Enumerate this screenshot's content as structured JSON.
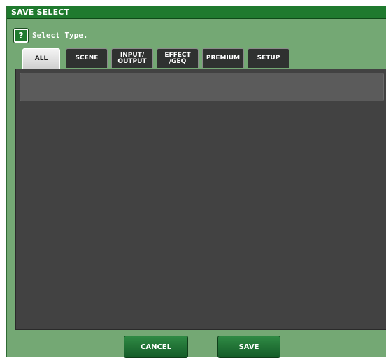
{
  "window": {
    "title": "SAVE SELECT"
  },
  "prompt": {
    "icon": "help-icon",
    "icon_glyph": "?",
    "text": "Select Type."
  },
  "tabs": [
    {
      "id": "all",
      "label": "ALL",
      "selected": true
    },
    {
      "id": "scene",
      "label": "SCENE",
      "selected": false
    },
    {
      "id": "input-output",
      "label": "INPUT/\nOUTPUT",
      "selected": false
    },
    {
      "id": "effect-geq",
      "label": "EFFECT\n/GEQ",
      "selected": false
    },
    {
      "id": "premium",
      "label": "PREMIUM",
      "selected": false
    },
    {
      "id": "setup",
      "label": "SETUP",
      "selected": false
    }
  ],
  "buttons": {
    "cancel": "CANCEL",
    "save": "SAVE"
  },
  "colors": {
    "window_bg": "#74a874",
    "titlebar": "#1f7a2e",
    "panel_bg": "#424242",
    "row_bg": "#5b5b5b",
    "button": "#1f7a2e"
  }
}
